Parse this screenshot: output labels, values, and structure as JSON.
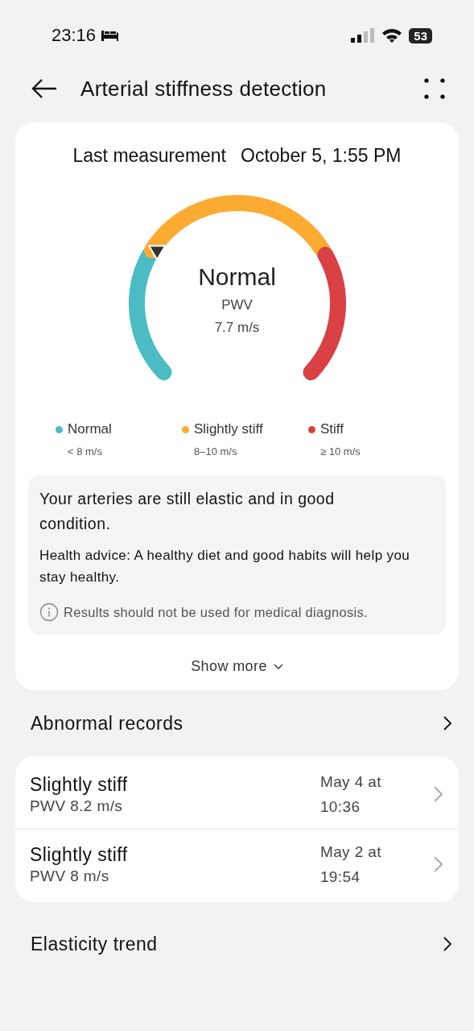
{
  "status_bar": {
    "time": "23:16",
    "battery": "53"
  },
  "header": {
    "title": "Arterial stiffness detection"
  },
  "measurement": {
    "label": "Last measurement",
    "date": "October 5, 1:55 PM",
    "gauge": {
      "status": "Normal",
      "metric": "PWV",
      "value": "7.7 m/s"
    },
    "legend": [
      {
        "label": "Normal",
        "range": "< 8 m/s",
        "color": "#4bbcc4"
      },
      {
        "label": "Slightly stiff",
        "range": "8–10 m/s",
        "color": "#fbab32"
      },
      {
        "label": "Stiff",
        "range": "≥ 10 m/s",
        "color": "#d94144"
      }
    ],
    "summary": "Your arteries are still elastic and in good condition.",
    "advice": "Health advice: A healthy diet and good habits will help you stay healthy.",
    "disclaimer": "Results should not be used for medical diagnosis.",
    "show_more": "Show more"
  },
  "abnormal_records": {
    "title": "Abnormal records",
    "rows": [
      {
        "status": "Slightly stiff",
        "reading": "PWV 8.2 m/s",
        "time": "May 4 at 10:36"
      },
      {
        "status": "Slightly stiff",
        "reading": "PWV 8 m/s",
        "time": "May 2 at 19:54"
      }
    ]
  },
  "trend": {
    "title": "Elasticity trend"
  }
}
